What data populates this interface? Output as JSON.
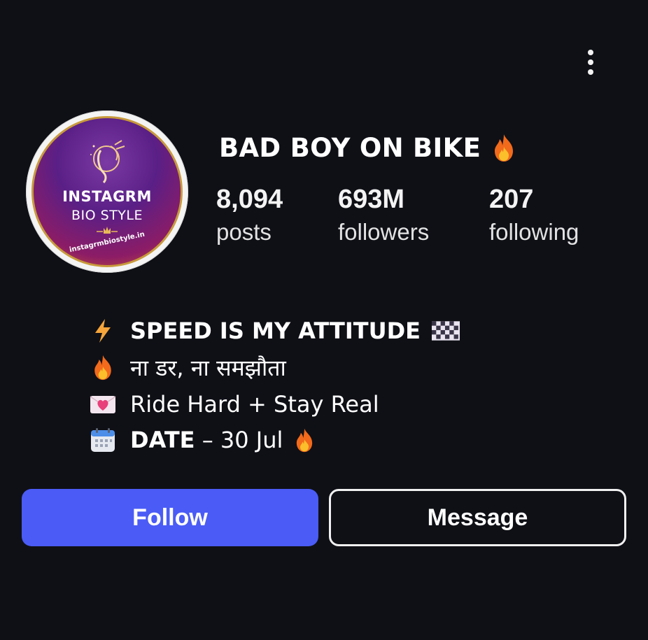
{
  "profile": {
    "username": "BAD BOY ON BIKE",
    "username_emoji": "fire-icon",
    "avatar": {
      "line1": "INSTAGRM",
      "line2": "BIO STYLE",
      "site": "instagrmbiostyle.in"
    }
  },
  "stats": {
    "posts": {
      "value": "8,094",
      "label": "posts"
    },
    "followers": {
      "value": "693M",
      "label": "followers"
    },
    "following": {
      "value": "207",
      "label": "following"
    }
  },
  "bio": {
    "line1": {
      "icon": "lightning-icon",
      "text": "SPEED IS MY ATTITUDE",
      "trail_icon": "checkered-flag-icon"
    },
    "line2": {
      "icon": "fire-icon",
      "text": "ना डर, ना समझौता"
    },
    "line3": {
      "icon": "heart-letter-icon",
      "text": "Ride Hard + Stay Real"
    },
    "line4": {
      "icon": "calendar-icon",
      "bold": "DATE",
      "text": " – 30 Jul",
      "trail_icon": "fire-icon"
    }
  },
  "actions": {
    "follow_label": "Follow",
    "message_label": "Message"
  },
  "colors": {
    "background": "#0f1016",
    "follow_button": "#4a5cf5",
    "text": "#ffffff"
  }
}
